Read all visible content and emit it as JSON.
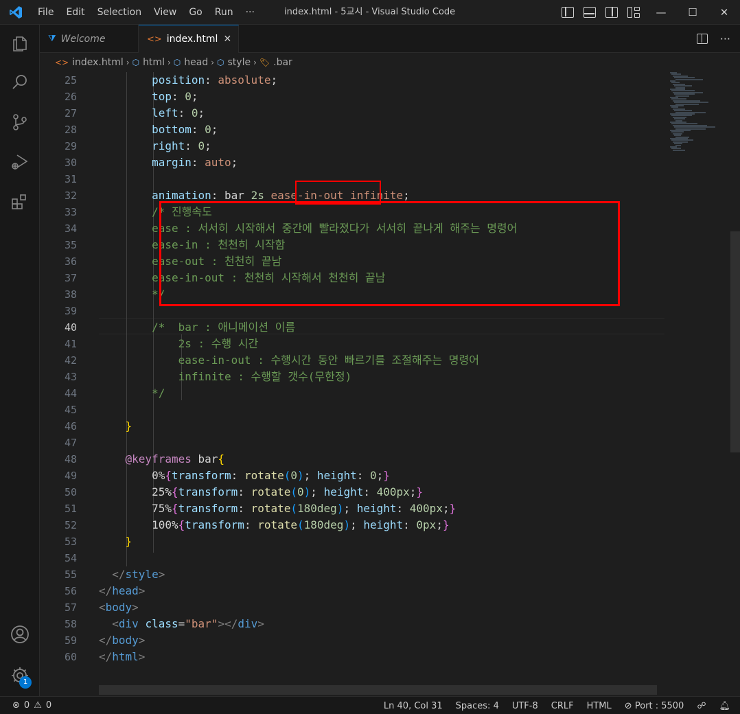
{
  "titlebar": {
    "menu": [
      "File",
      "Edit",
      "Selection",
      "View",
      "Go",
      "Run",
      "···"
    ],
    "title": "index.html - 5교시 - Visual Studio Code",
    "controls": {
      "minimize": "—",
      "maximize": "☐",
      "close": "✕"
    }
  },
  "tabs": [
    {
      "label": "Welcome",
      "icon": "vscode-icon",
      "active": false
    },
    {
      "label": "index.html",
      "icon": "html-icon",
      "active": true,
      "close": "✕"
    }
  ],
  "breadcrumb": [
    "index.html",
    "html",
    "head",
    "style",
    ".bar"
  ],
  "editor": {
    "lines": [
      {
        "n": 25,
        "tokens": [
          [
            "pr",
            "        position"
          ],
          [
            "pn",
            ": "
          ],
          [
            "vl",
            "absolute"
          ],
          [
            "pn",
            ";"
          ]
        ]
      },
      {
        "n": 26,
        "tokens": [
          [
            "pr",
            "        top"
          ],
          [
            "pn",
            ": "
          ],
          [
            "nm",
            "0"
          ],
          [
            "pn",
            ";"
          ]
        ]
      },
      {
        "n": 27,
        "tokens": [
          [
            "pr",
            "        left"
          ],
          [
            "pn",
            ": "
          ],
          [
            "nm",
            "0"
          ],
          [
            "pn",
            ";"
          ]
        ]
      },
      {
        "n": 28,
        "tokens": [
          [
            "pr",
            "        bottom"
          ],
          [
            "pn",
            ": "
          ],
          [
            "nm",
            "0"
          ],
          [
            "pn",
            ";"
          ]
        ]
      },
      {
        "n": 29,
        "tokens": [
          [
            "pr",
            "        right"
          ],
          [
            "pn",
            ": "
          ],
          [
            "nm",
            "0"
          ],
          [
            "pn",
            ";"
          ]
        ]
      },
      {
        "n": 30,
        "tokens": [
          [
            "pr",
            "        margin"
          ],
          [
            "pn",
            ": "
          ],
          [
            "vl",
            "auto"
          ],
          [
            "pn",
            ";"
          ]
        ]
      },
      {
        "n": 31,
        "tokens": []
      },
      {
        "n": 32,
        "tokens": [
          [
            "pr",
            "        animation"
          ],
          [
            "pn",
            ": bar "
          ],
          [
            "nm",
            "2s"
          ],
          [
            "pn",
            " "
          ],
          [
            "vl",
            "ease-in-out"
          ],
          [
            "pn",
            " "
          ],
          [
            "vl",
            "infinite"
          ],
          [
            "pn",
            ";"
          ]
        ]
      },
      {
        "n": 33,
        "tokens": [
          [
            "cm",
            "        /* 진행속도"
          ]
        ]
      },
      {
        "n": 34,
        "tokens": [
          [
            "cm",
            "        ease : 서서히 시작해서 중간에 빨라졌다가 서서히 끝나게 해주는 명령어"
          ]
        ]
      },
      {
        "n": 35,
        "tokens": [
          [
            "cm",
            "        ease-in : 천천히 시작함"
          ]
        ]
      },
      {
        "n": 36,
        "tokens": [
          [
            "cm",
            "        ease-out : 천천히 끝남"
          ]
        ]
      },
      {
        "n": 37,
        "tokens": [
          [
            "cm",
            "        ease-in-out : 천천히 시작해서 천천히 끝남"
          ]
        ]
      },
      {
        "n": 38,
        "tokens": [
          [
            "cm",
            "        */"
          ]
        ]
      },
      {
        "n": 39,
        "tokens": []
      },
      {
        "n": 40,
        "tokens": [
          [
            "cm",
            "        /*  bar : 애니메이션 이름"
          ]
        ]
      },
      {
        "n": 41,
        "tokens": [
          [
            "cm",
            "            2s : 수행 시간"
          ]
        ]
      },
      {
        "n": 42,
        "tokens": [
          [
            "cm",
            "            ease-in-out : 수행시간 동안 빠르기를 조절해주는 명령어"
          ]
        ]
      },
      {
        "n": 43,
        "tokens": [
          [
            "cm",
            "            infinite : 수행할 갯수(무한정)"
          ]
        ]
      },
      {
        "n": 44,
        "tokens": [
          [
            "cm",
            "        */"
          ]
        ]
      },
      {
        "n": 45,
        "tokens": []
      },
      {
        "n": 46,
        "tokens": [
          [
            "pn",
            "    "
          ],
          [
            "by",
            "}"
          ]
        ]
      },
      {
        "n": 47,
        "tokens": []
      },
      {
        "n": 48,
        "tokens": [
          [
            "kw",
            "    @keyframes"
          ],
          [
            "pn",
            " bar"
          ],
          [
            "by",
            "{"
          ]
        ]
      },
      {
        "n": 49,
        "tokens": [
          [
            "pn",
            "        0%"
          ],
          [
            "bp",
            "{"
          ],
          [
            "pr",
            "transform"
          ],
          [
            "pn",
            ": "
          ],
          [
            "fn",
            "rotate"
          ],
          [
            "bb",
            "("
          ],
          [
            "nm",
            "0"
          ],
          [
            "bb",
            ")"
          ],
          [
            "pn",
            "; "
          ],
          [
            "pr",
            "height"
          ],
          [
            "pn",
            ": "
          ],
          [
            "nm",
            "0"
          ],
          [
            "pn",
            ";"
          ],
          [
            "bp",
            "}"
          ]
        ]
      },
      {
        "n": 50,
        "tokens": [
          [
            "pn",
            "        25%"
          ],
          [
            "bp",
            "{"
          ],
          [
            "pr",
            "transform"
          ],
          [
            "pn",
            ": "
          ],
          [
            "fn",
            "rotate"
          ],
          [
            "bb",
            "("
          ],
          [
            "nm",
            "0"
          ],
          [
            "bb",
            ")"
          ],
          [
            "pn",
            "; "
          ],
          [
            "pr",
            "height"
          ],
          [
            "pn",
            ": "
          ],
          [
            "nm",
            "400px"
          ],
          [
            "pn",
            ";"
          ],
          [
            "bp",
            "}"
          ]
        ]
      },
      {
        "n": 51,
        "tokens": [
          [
            "pn",
            "        75%"
          ],
          [
            "bp",
            "{"
          ],
          [
            "pr",
            "transform"
          ],
          [
            "pn",
            ": "
          ],
          [
            "fn",
            "rotate"
          ],
          [
            "bb",
            "("
          ],
          [
            "nm",
            "180deg"
          ],
          [
            "bb",
            ")"
          ],
          [
            "pn",
            "; "
          ],
          [
            "pr",
            "height"
          ],
          [
            "pn",
            ": "
          ],
          [
            "nm",
            "400px"
          ],
          [
            "pn",
            ";"
          ],
          [
            "bp",
            "}"
          ]
        ]
      },
      {
        "n": 52,
        "tokens": [
          [
            "pn",
            "        100%"
          ],
          [
            "bp",
            "{"
          ],
          [
            "pr",
            "transform"
          ],
          [
            "pn",
            ": "
          ],
          [
            "fn",
            "rotate"
          ],
          [
            "bb",
            "("
          ],
          [
            "nm",
            "180deg"
          ],
          [
            "bb",
            ")"
          ],
          [
            "pn",
            "; "
          ],
          [
            "pr",
            "height"
          ],
          [
            "pn",
            ": "
          ],
          [
            "nm",
            "0px"
          ],
          [
            "pn",
            ";"
          ],
          [
            "bp",
            "}"
          ]
        ]
      },
      {
        "n": 53,
        "tokens": [
          [
            "pn",
            "    "
          ],
          [
            "by",
            "}"
          ]
        ]
      },
      {
        "n": 54,
        "tokens": []
      },
      {
        "n": 55,
        "tokens": [
          [
            "pn",
            "  "
          ],
          [
            "tg",
            "</"
          ],
          [
            "tn",
            "style"
          ],
          [
            "tg",
            ">"
          ]
        ]
      },
      {
        "n": 56,
        "tokens": [
          [
            "tg",
            "</"
          ],
          [
            "tn",
            "head"
          ],
          [
            "tg",
            ">"
          ]
        ]
      },
      {
        "n": 57,
        "tokens": [
          [
            "tg",
            "<"
          ],
          [
            "tn",
            "body"
          ],
          [
            "tg",
            ">"
          ]
        ]
      },
      {
        "n": 58,
        "tokens": [
          [
            "pn",
            "  "
          ],
          [
            "tg",
            "<"
          ],
          [
            "tn",
            "div"
          ],
          [
            "pn",
            " "
          ],
          [
            "at",
            "class"
          ],
          [
            "pn",
            "="
          ],
          [
            "av",
            "\"bar\""
          ],
          [
            "tg",
            "></"
          ],
          [
            "tn",
            "div"
          ],
          [
            "tg",
            ">"
          ]
        ]
      },
      {
        "n": 59,
        "tokens": [
          [
            "tg",
            "</"
          ],
          [
            "tn",
            "body"
          ],
          [
            "tg",
            ">"
          ]
        ]
      },
      {
        "n": 60,
        "tokens": [
          [
            "tg",
            "</"
          ],
          [
            "tn",
            "html"
          ],
          [
            "tg",
            ">"
          ]
        ]
      }
    ],
    "current_line": 40
  },
  "statusbar": {
    "errors": "0",
    "warnings": "0",
    "position": "Ln 40, Col 31",
    "spaces": "Spaces: 4",
    "encoding": "UTF-8",
    "eol": "CRLF",
    "language": "HTML",
    "port": "Port : 5500"
  },
  "activity": {
    "badge": "1"
  },
  "colors": {
    "accent": "#0078d4",
    "highlight": "#ff0000",
    "comment": "#6a9955"
  }
}
